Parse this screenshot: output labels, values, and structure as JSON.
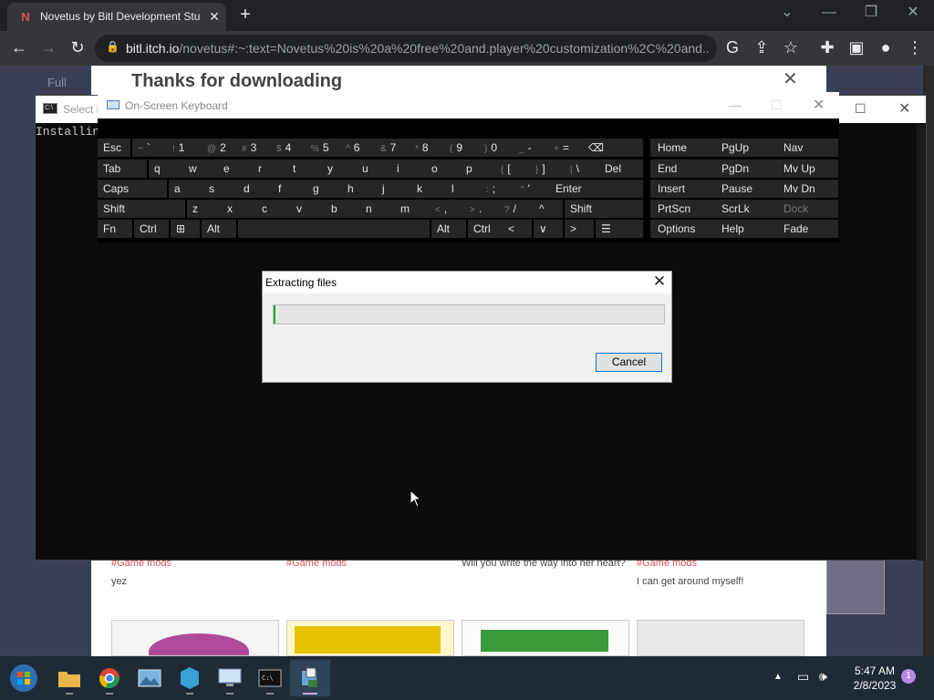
{
  "browser": {
    "tab_title": "Novetus by Bitl Development Stu",
    "favicon": "N",
    "url_host": "bitl.itch.io",
    "url_rest": "/novetus#:~:text=Novetus%20is%20a%20free%20and.player%20customization%2C%20and...",
    "accent": "#35363a"
  },
  "page": {
    "heading": "Thanks for downloading",
    "faded_text": "Full",
    "comments": [
      {
        "tag": "#Game mods",
        "text": "yez"
      },
      {
        "tag": "#Game mods",
        "text": ""
      },
      {
        "tag": "",
        "text": "Will you write the way into her heart?"
      },
      {
        "tag": "#Game mods",
        "text": "I can get around myself!"
      }
    ]
  },
  "console": {
    "title": "Select N",
    "text": "Installin"
  },
  "osk": {
    "title": "On-Screen Keyboard",
    "rows": [
      [
        [
          "Esc",
          ""
        ],
        [
          "`",
          "~"
        ],
        [
          "1",
          "!"
        ],
        [
          "2",
          "@"
        ],
        [
          "3",
          "#"
        ],
        [
          "4",
          "$"
        ],
        [
          "5",
          "%"
        ],
        [
          "6",
          "^"
        ],
        [
          "7",
          "&"
        ],
        [
          "8",
          "*"
        ],
        [
          "9",
          "("
        ],
        [
          "0",
          ")"
        ],
        [
          "-",
          "_"
        ],
        [
          "=",
          "+"
        ],
        [
          "⌫",
          ""
        ]
      ],
      [
        [
          "Tab",
          ""
        ],
        [
          "q",
          ""
        ],
        [
          "w",
          ""
        ],
        [
          "e",
          ""
        ],
        [
          "r",
          ""
        ],
        [
          "t",
          ""
        ],
        [
          "y",
          ""
        ],
        [
          "u",
          ""
        ],
        [
          "i",
          ""
        ],
        [
          "o",
          ""
        ],
        [
          "p",
          ""
        ],
        [
          "[",
          "{"
        ],
        [
          "]",
          "}"
        ],
        [
          "\\",
          "|"
        ],
        [
          "Del",
          ""
        ]
      ],
      [
        [
          "Caps",
          ""
        ],
        [
          "a",
          ""
        ],
        [
          "s",
          ""
        ],
        [
          "d",
          ""
        ],
        [
          "f",
          ""
        ],
        [
          "g",
          ""
        ],
        [
          "h",
          ""
        ],
        [
          "j",
          ""
        ],
        [
          "k",
          ""
        ],
        [
          "l",
          ""
        ],
        [
          ";",
          ":"
        ],
        [
          "'",
          "\""
        ],
        [
          "Enter",
          ""
        ]
      ],
      [
        [
          "Shift",
          ""
        ],
        [
          "z",
          ""
        ],
        [
          "x",
          ""
        ],
        [
          "c",
          ""
        ],
        [
          "v",
          ""
        ],
        [
          "b",
          ""
        ],
        [
          "n",
          ""
        ],
        [
          "m",
          ""
        ],
        [
          ",",
          "<"
        ],
        [
          ".",
          ">"
        ],
        [
          "/",
          "?"
        ],
        [
          "^",
          ""
        ],
        [
          "Shift",
          ""
        ]
      ],
      [
        [
          "Fn",
          ""
        ],
        [
          "Ctrl",
          ""
        ],
        [
          "⊞",
          ""
        ],
        [
          "Alt",
          ""
        ],
        [
          "",
          ""
        ],
        [
          "Alt",
          ""
        ],
        [
          "Ctrl",
          ""
        ],
        [
          "<",
          ""
        ],
        [
          "∨",
          ""
        ],
        [
          ">",
          ""
        ],
        [
          "☰",
          ""
        ]
      ]
    ],
    "nav": [
      [
        "Home",
        "PgUp",
        "Nav"
      ],
      [
        "End",
        "PgDn",
        "Mv Up"
      ],
      [
        "Insert",
        "Pause",
        "Mv Dn"
      ],
      [
        "PrtScn",
        "ScrLk",
        "Dock"
      ],
      [
        "Options",
        "Help",
        "Fade"
      ]
    ]
  },
  "dialog": {
    "title": "Extracting files",
    "progress": 0.005,
    "cancel_label": "Cancel"
  },
  "taskbar": {
    "time": "5:47 AM",
    "date": "2/8/2023",
    "notification_count": "1",
    "apps": [
      "start-orb-icon",
      "file-explorer-icon",
      "chrome-icon",
      "photos-icon",
      "app-icon",
      "remote-desktop-icon",
      "cmd-icon",
      "installer-icon"
    ]
  }
}
